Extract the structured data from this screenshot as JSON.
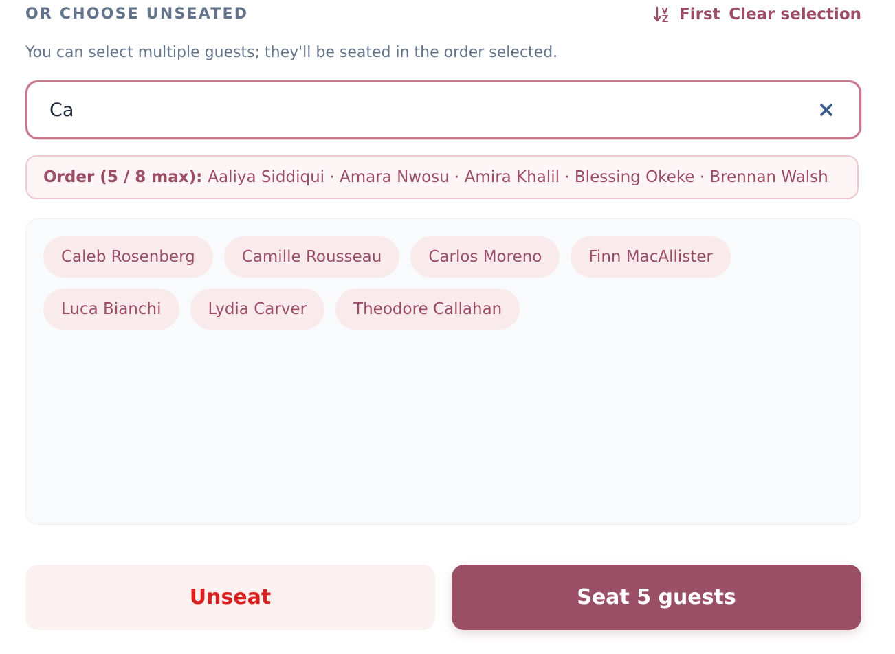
{
  "header": {
    "section_title": "OR CHOOSE UNSEATED",
    "sort_label": "First",
    "sort_icon": "sort-ascending-az-icon",
    "clear_label": "Clear selection"
  },
  "hint": "You can select multiple guests; they'll be seated in the order selected.",
  "search": {
    "value": "Ca",
    "clear_icon": "close-icon"
  },
  "order": {
    "label": "Order (5 / 8 max):",
    "names": "Aaliya Siddiqui · Amara Nwosu · Amira Khalil · Blessing Okeke · Brennan Walsh"
  },
  "guests": [
    "Caleb Rosenberg",
    "Camille Rousseau",
    "Carlos Moreno",
    "Finn MacAllister",
    "Luca Bianchi",
    "Lydia Carver",
    "Theodore Callahan"
  ],
  "actions": {
    "unseat_label": "Unseat",
    "seat_label": "Seat 5 guests"
  },
  "colors": {
    "accent": "#9b4d66",
    "danger": "#dc1f1f",
    "muted": "#64748b"
  }
}
